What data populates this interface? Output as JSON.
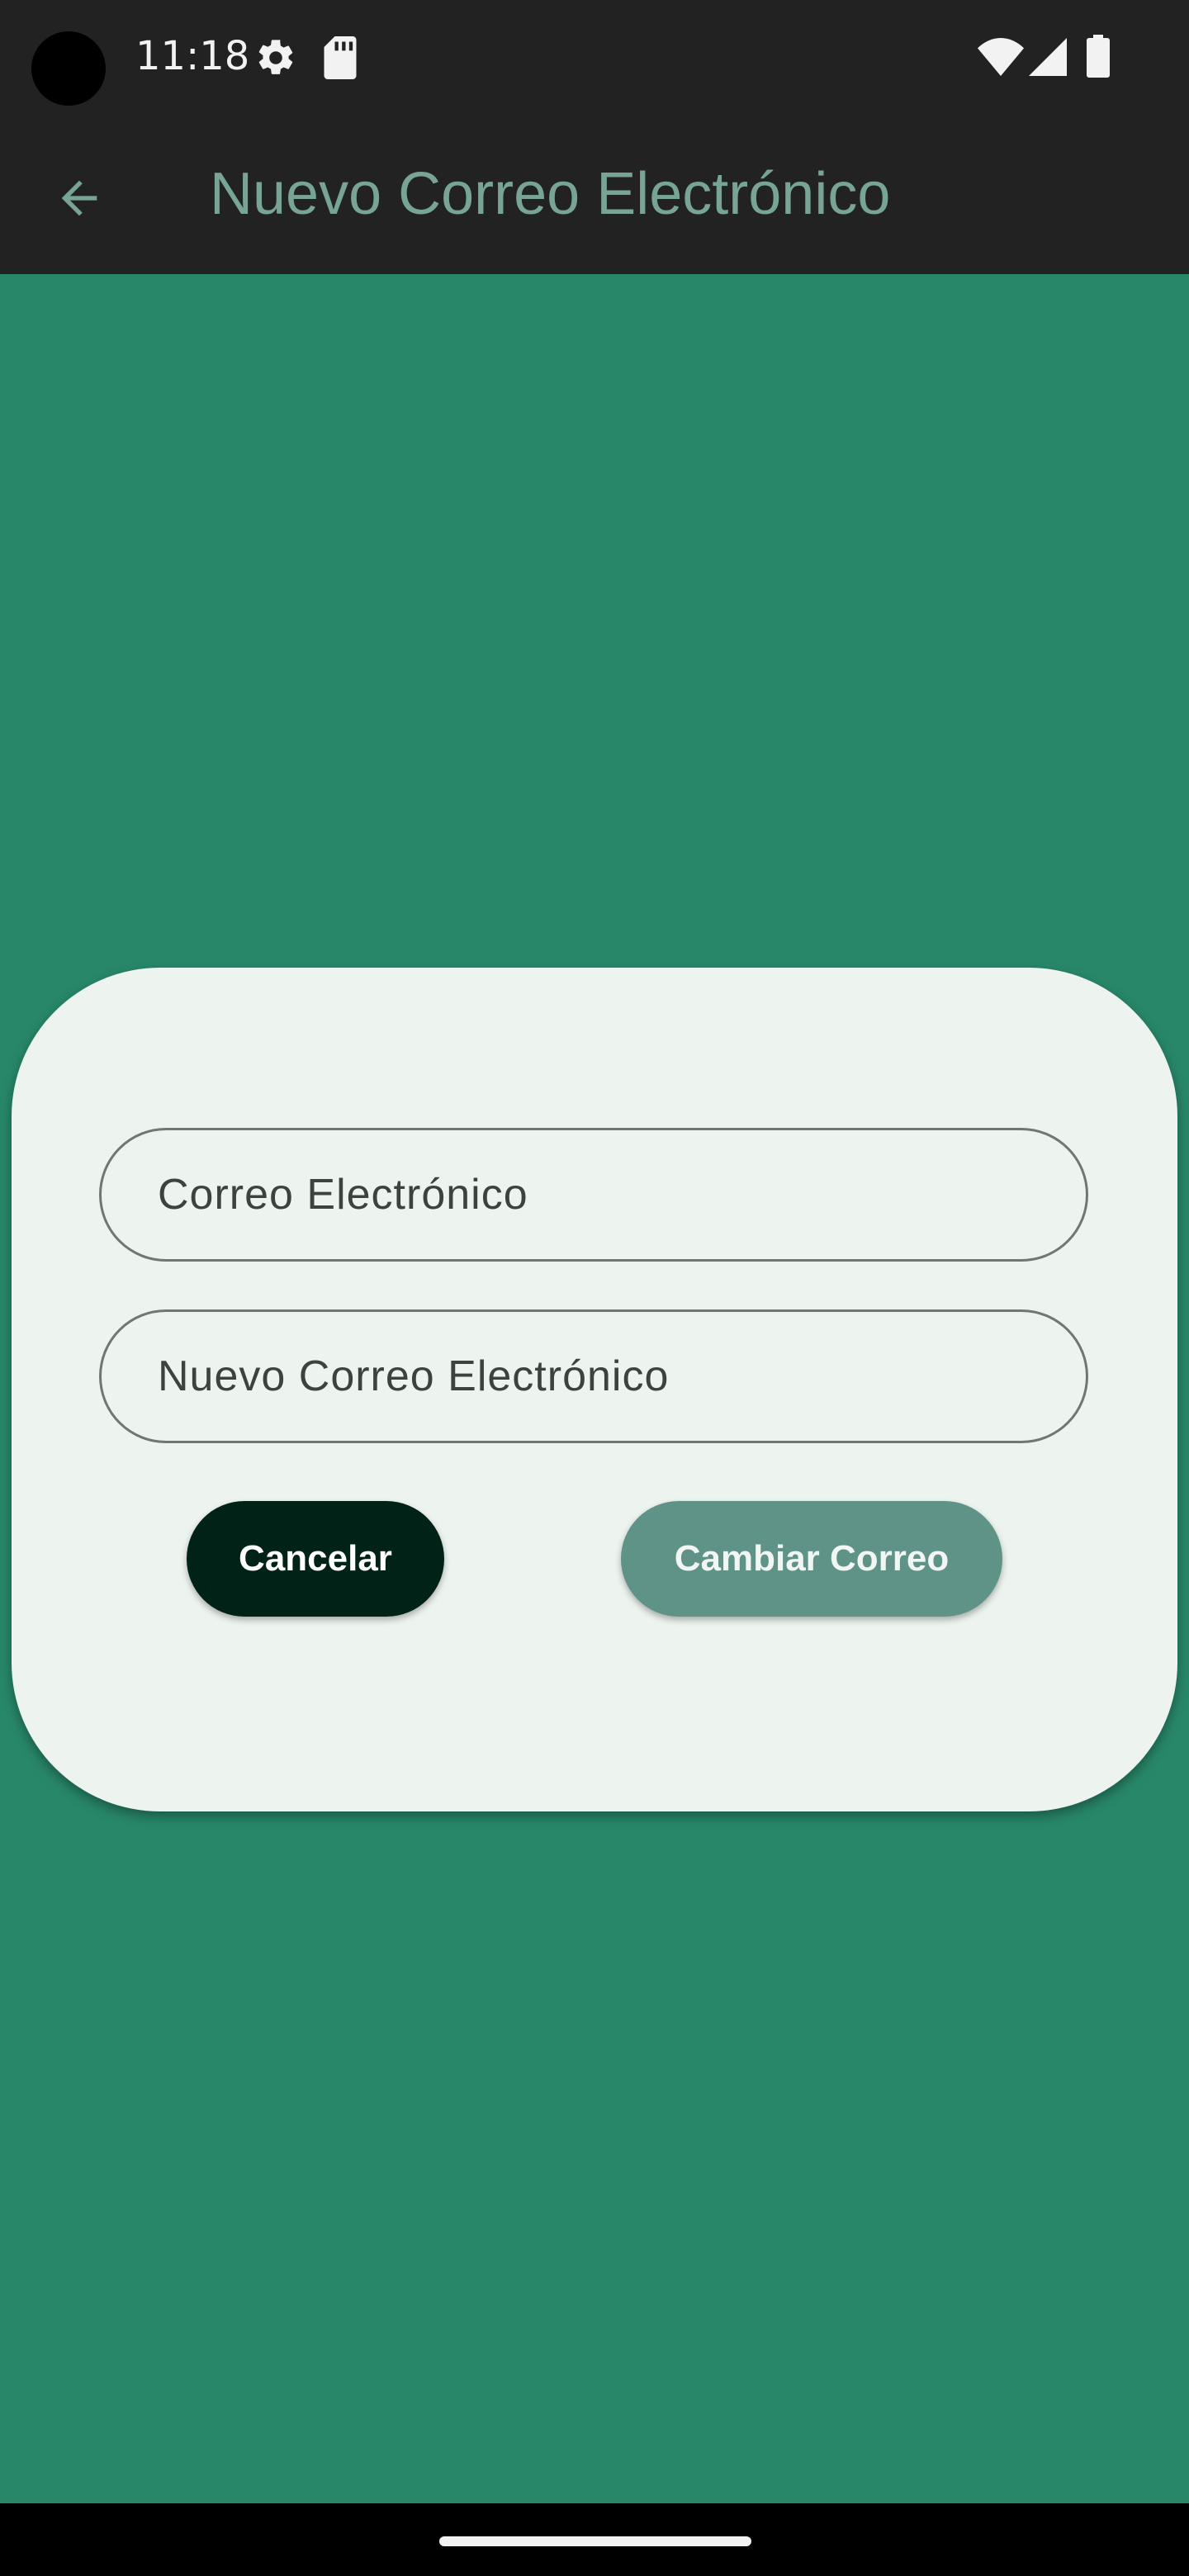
{
  "status_bar": {
    "time": "11:18",
    "icons": [
      "settings-gear-icon",
      "sd-card-icon",
      "wifi-icon",
      "cellular-signal-icon",
      "battery-icon"
    ]
  },
  "app_bar": {
    "title": "Nuevo Correo Electrónico",
    "back_icon": "arrow-back-icon"
  },
  "dialog": {
    "email_field": {
      "label": "Correo Electrónico"
    },
    "new_email_field": {
      "label": "Nuevo Correo Electrónico"
    },
    "cancel_button": {
      "label": "Cancelar"
    },
    "change_button": {
      "label": "Cambiar Correo"
    }
  },
  "colors": {
    "background": "#288769",
    "bars": "#222222",
    "dialog": "#edf4ef",
    "title": "#78a494",
    "cancel_button": "#012217",
    "change_button": "#5f9387"
  }
}
